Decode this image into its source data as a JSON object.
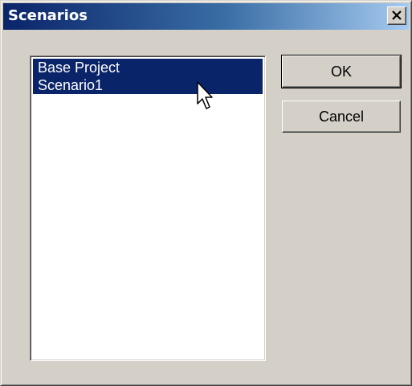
{
  "window": {
    "title": "Scenarios",
    "close_label": "Close"
  },
  "scenario_list": {
    "items": [
      {
        "label": "Base Project",
        "selected": true
      },
      {
        "label": "Scenario1",
        "selected": true
      }
    ],
    "selection_color": "#0a246a"
  },
  "buttons": {
    "ok_label": "OK",
    "cancel_label": "Cancel"
  },
  "colors": {
    "dialog_face": "#d4d0c8",
    "titlebar_start": "#0a246a",
    "titlebar_end": "#a6caf0"
  },
  "icons": {
    "close": "close-icon",
    "pointer": "mouse-pointer-icon"
  }
}
